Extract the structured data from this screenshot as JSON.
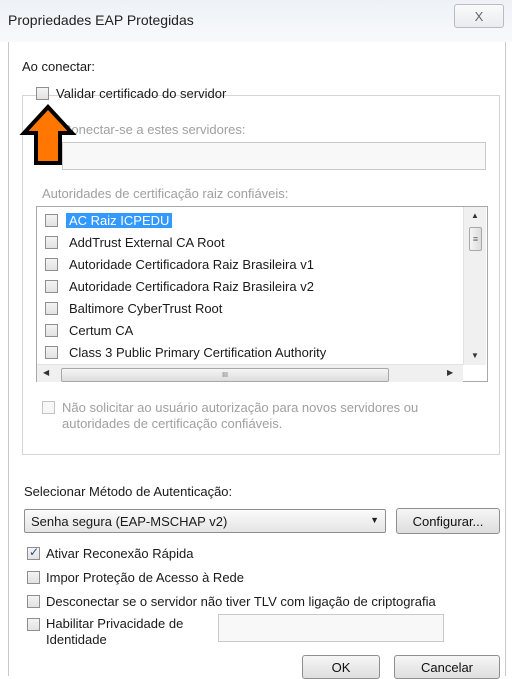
{
  "window": {
    "title": "Propriedades EAP Protegidas",
    "close_label": "X"
  },
  "connect": {
    "heading": "Ao conectar:",
    "validate_cert_label": "Validar certificado do servidor",
    "validate_cert_checked": false,
    "connect_servers_label": "Conectar-se a estes servidores:",
    "connect_servers_value": "",
    "trusted_roots_label": "Autoridades de certificação raiz confiáveis:",
    "trusted_roots": [
      {
        "label": "AC Raiz ICPEDU",
        "checked": false,
        "selected": true
      },
      {
        "label": "AddTrust External CA Root",
        "checked": false,
        "selected": false
      },
      {
        "label": "Autoridade Certificadora Raiz Brasileira v1",
        "checked": false,
        "selected": false
      },
      {
        "label": "Autoridade Certificadora Raiz Brasileira v2",
        "checked": false,
        "selected": false
      },
      {
        "label": "Baltimore CyberTrust Root",
        "checked": false,
        "selected": false
      },
      {
        "label": "Certum CA",
        "checked": false,
        "selected": false
      },
      {
        "label": "Class 3 Public Primary Certification Authority",
        "checked": false,
        "selected": false
      }
    ],
    "hscroll_grip": "III",
    "no_prompt_label_line1": "Não solicitar ao usuário autorização para novos servidores ou",
    "no_prompt_label_line2": "autoridades de certificação confiáveis."
  },
  "auth": {
    "heading": "Selecionar Método de Autenticação:",
    "method_value": "Senha segura (EAP-MSCHAP v2)",
    "configure_label": "Configurar..."
  },
  "options": {
    "fast_reconnect_label": "Ativar Reconexão Rápida",
    "fast_reconnect_checked": true,
    "nap_label": "Impor Proteção de Acesso à Rede",
    "disconnect_tlv_label": "Desconectar se o servidor não tiver TLV com ligação de criptografia",
    "identity_privacy_line1": "Habilitar Privacidade de",
    "identity_privacy_line2": "Identidade",
    "identity_value": ""
  },
  "footer": {
    "ok_label": "OK",
    "cancel_label": "Cancelar"
  },
  "annotation": {
    "arrow_color": "#ff7700"
  }
}
